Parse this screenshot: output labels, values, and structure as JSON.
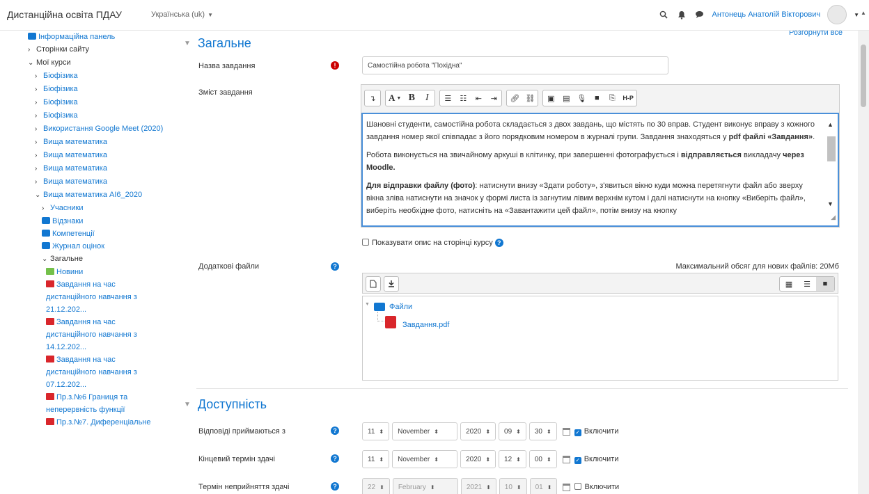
{
  "navbar": {
    "site_name": "Дистанційна освіта ПДАУ",
    "language": "Українська (uk)",
    "user_name": "Антонець Анатолій Вікторович"
  },
  "drawer": {
    "items": [
      {
        "label": "Інформаційна панель",
        "level": 1,
        "chevron": "",
        "icon": "dashboard-icon",
        "color": "link"
      },
      {
        "label": "Сторінки сайту",
        "level": 1,
        "chevron": "›",
        "icon": "",
        "color": "dark"
      },
      {
        "label": "Мої курси",
        "level": 1,
        "chevron": "⌄",
        "icon": "",
        "color": "dark"
      },
      {
        "label": "Біофізика",
        "level": 2,
        "chevron": "›",
        "icon": "",
        "color": "link"
      },
      {
        "label": "Біофізика",
        "level": 2,
        "chevron": "›",
        "icon": "",
        "color": "link"
      },
      {
        "label": "Біофізика",
        "level": 2,
        "chevron": "›",
        "icon": "",
        "color": "link"
      },
      {
        "label": "Біофізика",
        "level": 2,
        "chevron": "›",
        "icon": "",
        "color": "link"
      },
      {
        "label": "Використання Google Meet (2020)",
        "level": 2,
        "chevron": "›",
        "icon": "",
        "color": "link"
      },
      {
        "label": "Вища математика",
        "level": 2,
        "chevron": "›",
        "icon": "",
        "color": "link"
      },
      {
        "label": "Вища математика",
        "level": 2,
        "chevron": "›",
        "icon": "",
        "color": "link"
      },
      {
        "label": "Вища математика",
        "level": 2,
        "chevron": "›",
        "icon": "",
        "color": "link"
      },
      {
        "label": "Вища математика",
        "level": 2,
        "chevron": "›",
        "icon": "",
        "color": "link"
      },
      {
        "label": "Вища математика АІ6_2020",
        "level": 2,
        "chevron": "⌄",
        "icon": "",
        "color": "link"
      },
      {
        "label": "Учасники",
        "level": 3,
        "chevron": "›",
        "icon": "",
        "color": "link"
      },
      {
        "label": "Відзнаки",
        "level": 3,
        "chevron": "",
        "icon": "shield-icon",
        "color": "link"
      },
      {
        "label": "Компетенції",
        "level": 3,
        "chevron": "",
        "icon": "checkbox-icon",
        "color": "link"
      },
      {
        "label": "Журнал оцінок",
        "level": 3,
        "chevron": "",
        "icon": "table-icon",
        "color": "link"
      },
      {
        "label": "Загальне",
        "level": 3,
        "chevron": "⌄",
        "icon": "",
        "color": "dark"
      },
      {
        "label": "Новини",
        "level": 4,
        "chevron": "",
        "icon": "news-icon",
        "color": "link"
      },
      {
        "label": "Завдання на час дистанційного навчання з 21.12.202...",
        "level": 4,
        "chevron": "",
        "icon": "pdf-icon",
        "color": "link"
      },
      {
        "label": "Завдання на час дистанційного навчання з 14.12.202...",
        "level": 4,
        "chevron": "",
        "icon": "pdf-icon",
        "color": "link"
      },
      {
        "label": "Завдання на час дистанційного навчання з 07.12.202...",
        "level": 4,
        "chevron": "",
        "icon": "pdf-icon",
        "color": "link"
      },
      {
        "label": "Пр.з.№6 Границя та неперервність функції",
        "level": 4,
        "chevron": "",
        "icon": "pdf-icon",
        "color": "link"
      },
      {
        "label": "Пр.з.№7. Диференціальне",
        "level": 4,
        "chevron": "",
        "icon": "pdf-icon",
        "color": "link"
      }
    ]
  },
  "general": {
    "collapse_all": "Розгорнути все",
    "title": "Загальне",
    "name_label": "Назва завдання",
    "name_value": "Самостійна робота \"Похідна\"",
    "content_label": "Зміст завдання",
    "content_p1": "Шановні студенти, самостійна робота складається з двох завдань, що містять по 30 вправ. Студент виконує вправу з кожного завдання номер якої співпадає з його порядковим номером в журналі групи. Завдання знаходяться у ",
    "content_p1_bold": "pdf файлі «Завдання»",
    "content_p1_end": ".",
    "content_p2": "Робота виконується на звичайному аркуші в клітинку, при завершенні фотографується і ",
    "content_p2_bold": "відправляється",
    "content_p2_mid": " викладачу ",
    "content_p2_bold2": "через Moodle.",
    "content_p3_bold": "Для відправки файлу (фото)",
    "content_p3": ": натиснути внизу «Здати роботу», з'явиться вікно куди можна перетягнути файл або зверху вікна зліва натиснути на значок у формі листа із загнутим лівим верхнім кутом і далі натиснути на кнопку «Виберіть файл», виберіть необхідне фото, натисніть на «Завантажити цей файл», потім внизу на кнопку",
    "show_desc": "Показувати опис на сторінці курсу",
    "files_label": "Додаткові файли",
    "max_size": "Максимальний обсяг для нових файлів: 20Мб",
    "folder_name": "Файли",
    "file_name": "Завдання.pdf"
  },
  "availability": {
    "title": "Доступність",
    "enable_label": "Включити",
    "rows": [
      {
        "label": "Відповіді приймаються з",
        "day": "11",
        "month": "November",
        "year": "2020",
        "hour": "09",
        "minute": "30",
        "enabled": true
      },
      {
        "label": "Кінцевий термін здачі",
        "day": "11",
        "month": "November",
        "year": "2020",
        "hour": "12",
        "minute": "00",
        "enabled": true
      },
      {
        "label": "Термін неприйняття здачі",
        "day": "22",
        "month": "February",
        "year": "2021",
        "hour": "10",
        "minute": "01",
        "enabled": false
      }
    ]
  }
}
